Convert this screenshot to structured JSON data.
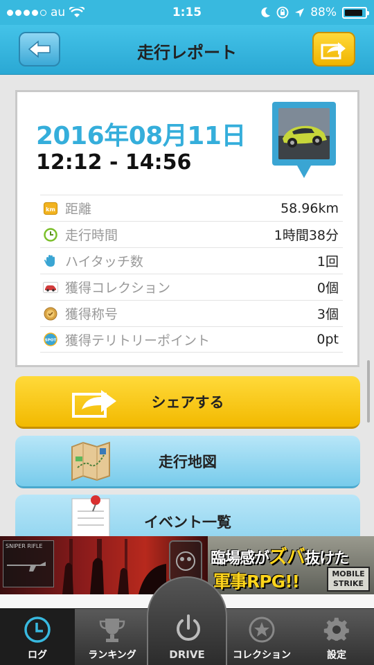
{
  "status_bar": {
    "carrier": "au",
    "time": "1:15",
    "battery": "88%",
    "battery_level": 0.88
  },
  "nav": {
    "title": "走行レポート",
    "back_icon": "arrow-left-icon",
    "share_icon": "share-arrow-icon"
  },
  "report": {
    "date": "2016年08月11日",
    "time_range": "12:12 - 14:56",
    "stats": [
      {
        "icon": "km-icon",
        "label": "距離",
        "value": "58.96km"
      },
      {
        "icon": "clock-icon",
        "label": "走行時間",
        "value": "1時間38分"
      },
      {
        "icon": "hand-icon",
        "label": "ハイタッチ数",
        "value": "1回"
      },
      {
        "icon": "car-icon",
        "label": "獲得コレクション",
        "value": "0個"
      },
      {
        "icon": "medal-icon",
        "label": "獲得称号",
        "value": "3個"
      },
      {
        "icon": "spot-icon",
        "label": "獲得テリトリーポイント",
        "value": "0pt"
      }
    ]
  },
  "actions": {
    "share": "シェアする",
    "map": "走行地図",
    "events": "イベント一覧"
  },
  "ad": {
    "line1_a": "臨場感が",
    "line1_b": "ズバ",
    "line1_c": "抜けた",
    "line2": "軍事RPG!!",
    "logo_top": "MOBILE",
    "logo_bottom": "STRIKE",
    "panel_label": "SNIPER RIFLE"
  },
  "tabs": [
    {
      "label": "ログ",
      "icon": "clock-icon"
    },
    {
      "label": "ランキング",
      "icon": "trophy-icon"
    },
    {
      "label": "DRIVE",
      "icon": "power-icon"
    },
    {
      "label": "コレクション",
      "icon": "star-icon"
    },
    {
      "label": "設定",
      "icon": "gear-icon"
    }
  ],
  "colors": {
    "primary_blue": "#38b9df",
    "accent_yellow": "#f2b900",
    "date_blue": "#35aedb"
  }
}
